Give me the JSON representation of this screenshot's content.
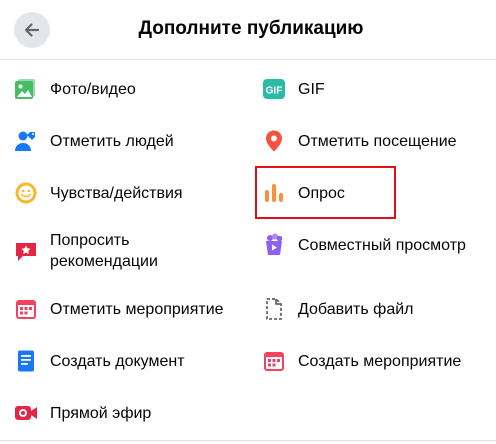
{
  "header": {
    "title": "Дополните публикацию",
    "back_icon": "arrow-left-icon"
  },
  "items_left": [
    {
      "label": "Фото/видео",
      "icon": "photo-video-icon"
    },
    {
      "label": "Отметить людей",
      "icon": "tag-people-icon"
    },
    {
      "label": "Чувства/действия",
      "icon": "feeling-emoji-icon"
    },
    {
      "label": "Попросить рекомендации",
      "icon": "recommendation-icon"
    },
    {
      "label": "Отметить мероприятие",
      "icon": "event-calendar-icon"
    },
    {
      "label": "Создать документ",
      "icon": "document-icon"
    },
    {
      "label": "Прямой эфир",
      "icon": "live-video-icon"
    }
  ],
  "items_right": [
    {
      "label": "GIF",
      "icon": "gif-icon"
    },
    {
      "label": "Отметить посещение",
      "icon": "location-pin-icon"
    },
    {
      "label": "Опрос",
      "icon": "poll-icon"
    },
    {
      "label": "Совместный просмотр",
      "icon": "watch-party-icon"
    },
    {
      "label": "Добавить файл",
      "icon": "file-icon"
    },
    {
      "label": "Создать мероприятие",
      "icon": "create-event-icon"
    }
  ],
  "colors": {
    "photo": "#45bd62",
    "tag": "#1877f2",
    "feeling": "#f7b928",
    "recommend": "#e42645",
    "event": "#f3425f",
    "document": "#1877f2",
    "live": "#e42645",
    "gif": "#2abba7",
    "location": "#f5533d",
    "poll": "#f7923a",
    "watch": "#8c62f3",
    "highlight": "#e0101a"
  }
}
